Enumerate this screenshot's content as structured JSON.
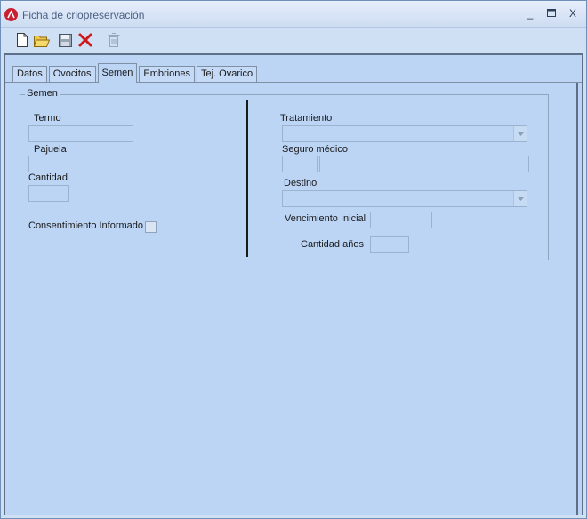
{
  "window": {
    "title": "Ficha de criopreservación",
    "minimize_glyph": "_",
    "maximize_glyph": "▭",
    "close_glyph": "X"
  },
  "toolbar": {
    "buttons": [
      {
        "name": "new-document-icon",
        "enabled": true
      },
      {
        "name": "open-folder-icon",
        "enabled": true
      },
      {
        "name": "save-icon",
        "enabled": true
      },
      {
        "name": "delete-x-icon",
        "enabled": true
      },
      {
        "name": "trash-icon",
        "enabled": false
      }
    ]
  },
  "tabs": [
    {
      "label": "Datos",
      "active": false
    },
    {
      "label": "Ovocitos",
      "active": false
    },
    {
      "label": "Semen",
      "active": true
    },
    {
      "label": "Embriones",
      "active": false
    },
    {
      "label": "Tej. Ovarico",
      "active": false
    }
  ],
  "semen": {
    "group_title": "Semen",
    "termo_label": "Termo",
    "termo_value": "",
    "pajuela_label": "Pajuela",
    "pajuela_value": "",
    "cantidad_label": "Cantidad",
    "cantidad_value": "",
    "consentimiento_label": "Consentimiento Informado",
    "consentimiento_checked": false,
    "tratamiento_label": "Tratamiento",
    "tratamiento_value": "",
    "seguro_label": "Seguro médico",
    "seguro_code": "",
    "seguro_name": "",
    "destino_label": "Destino",
    "destino_value": "",
    "vencimiento_label": "Vencimiento Inicial",
    "vencimiento_value": "",
    "cantidad_anos_label": "Cantidad años",
    "cantidad_anos_value": ""
  },
  "colors": {
    "accent": "#c8202f",
    "panel": "#bcd5f5",
    "titlebar": "#cddcf2"
  }
}
